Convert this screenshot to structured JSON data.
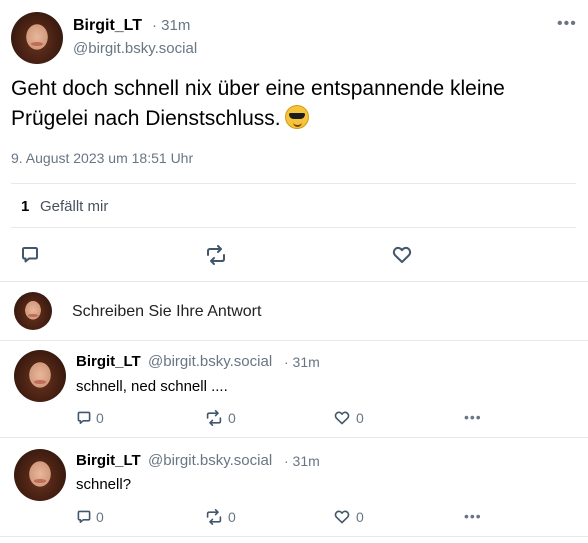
{
  "post": {
    "author_name": "Birgit_LT",
    "time": "· 31m",
    "handle": "@birgit.bsky.social",
    "text": "Geht doch schnell nix über eine entspannende kleine Prügelei nach Dienstschluss.",
    "date": "9. August 2023 um 18:51 Uhr",
    "likes_count": "1",
    "likes_label": "Gefällt mir",
    "more_label": "•••"
  },
  "reply_box": {
    "placeholder": "Schreiben Sie Ihre Antwort"
  },
  "replies": [
    {
      "author_name": "Birgit_LT",
      "handle": "@birgit.bsky.social",
      "time": "· 31m",
      "text": "schnell, ned schnell ....",
      "reply_count": "0",
      "repost_count": "0",
      "like_count": "0",
      "more_label": "•••"
    },
    {
      "author_name": "Birgit_LT",
      "handle": "@birgit.bsky.social",
      "time": "· 31m",
      "text": "schnell?",
      "reply_count": "0",
      "repost_count": "0",
      "like_count": "0",
      "more_label": "•••"
    }
  ],
  "colors": {
    "muted_text": "#687684",
    "icon": "#42576c",
    "divider": "#e6e9ec"
  },
  "icons": [
    "more-icon",
    "comment-icon",
    "repost-icon",
    "heart-icon",
    "sunglasses-emoji"
  ]
}
